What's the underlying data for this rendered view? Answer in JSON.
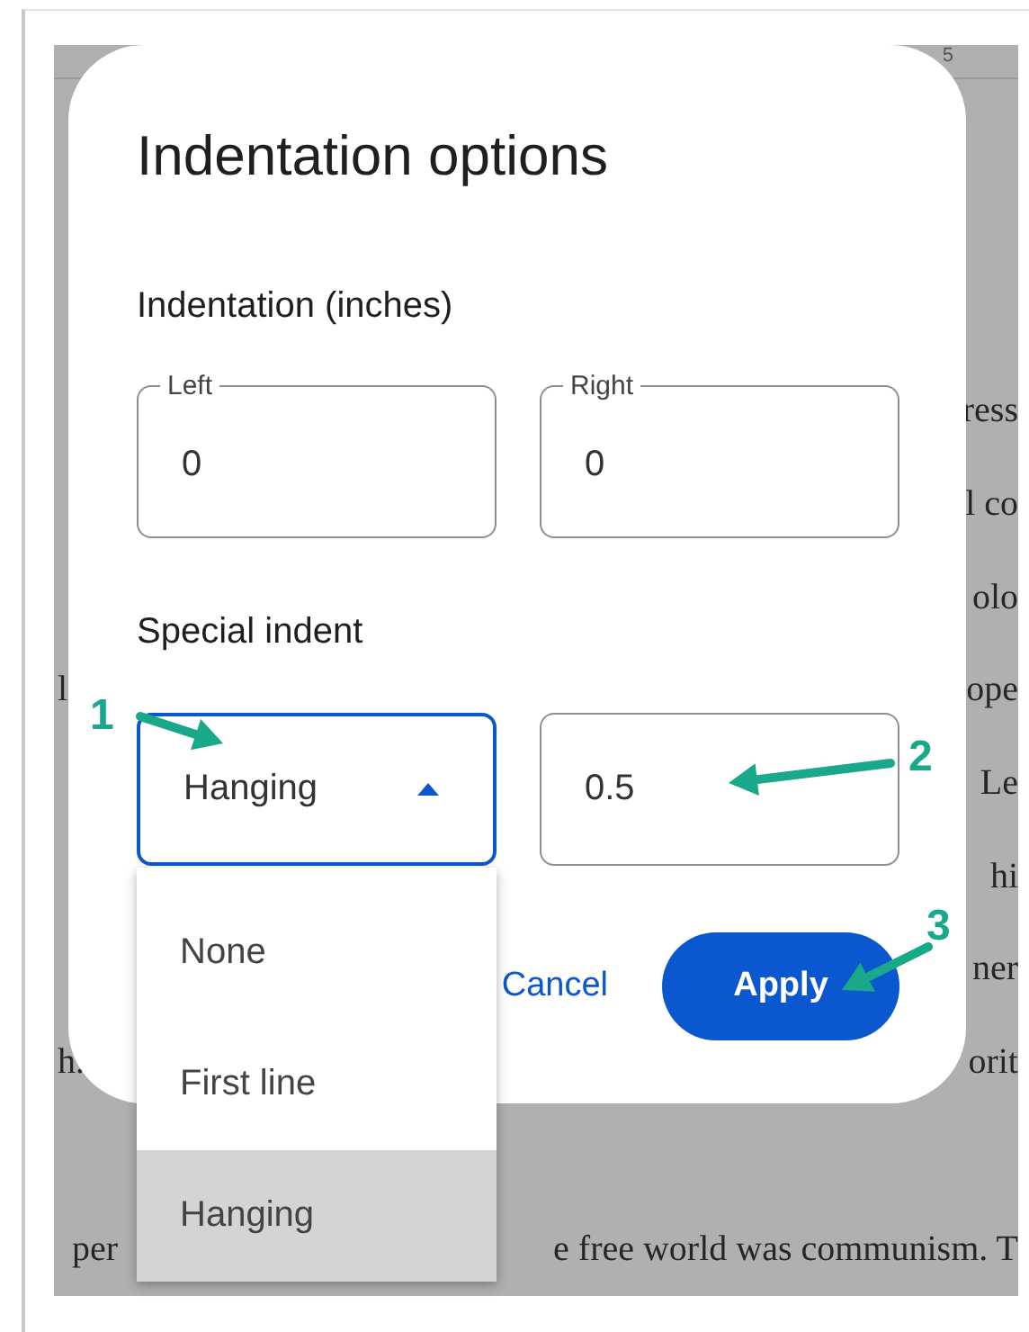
{
  "document": {
    "ruler_label": "5",
    "lines": [
      {
        "right": "ress"
      },
      {
        "right": "l co"
      },
      {
        "right": "olo"
      },
      {
        "left": "l",
        "right": "ope"
      },
      {
        "right": "Le"
      },
      {
        "right": "hi"
      },
      {
        "right": "ner"
      },
      {
        "left": "h.",
        "right": "orit"
      }
    ],
    "bottom_line": {
      "left": "per",
      "right": "e free world was communism. T"
    }
  },
  "dialog": {
    "title": "Indentation options",
    "section": "Indentation (inches)",
    "fields": [
      {
        "label": "Left",
        "value": "0"
      },
      {
        "label": "Right",
        "value": "0"
      }
    ],
    "special_label": "Special indent",
    "special_select": {
      "value": "Hanging",
      "expanded": true
    },
    "special_value": "0.5",
    "buttons": [
      {
        "label": "Cancel",
        "kind": "text"
      },
      {
        "label": "Apply",
        "kind": "filled"
      }
    ]
  },
  "menu": {
    "options": [
      {
        "label": "None",
        "selected": false
      },
      {
        "label": "First line",
        "selected": false
      },
      {
        "label": "Hanging",
        "selected": true
      }
    ]
  },
  "annotations": [
    {
      "number": "1"
    },
    {
      "number": "2"
    },
    {
      "number": "3"
    }
  ]
}
